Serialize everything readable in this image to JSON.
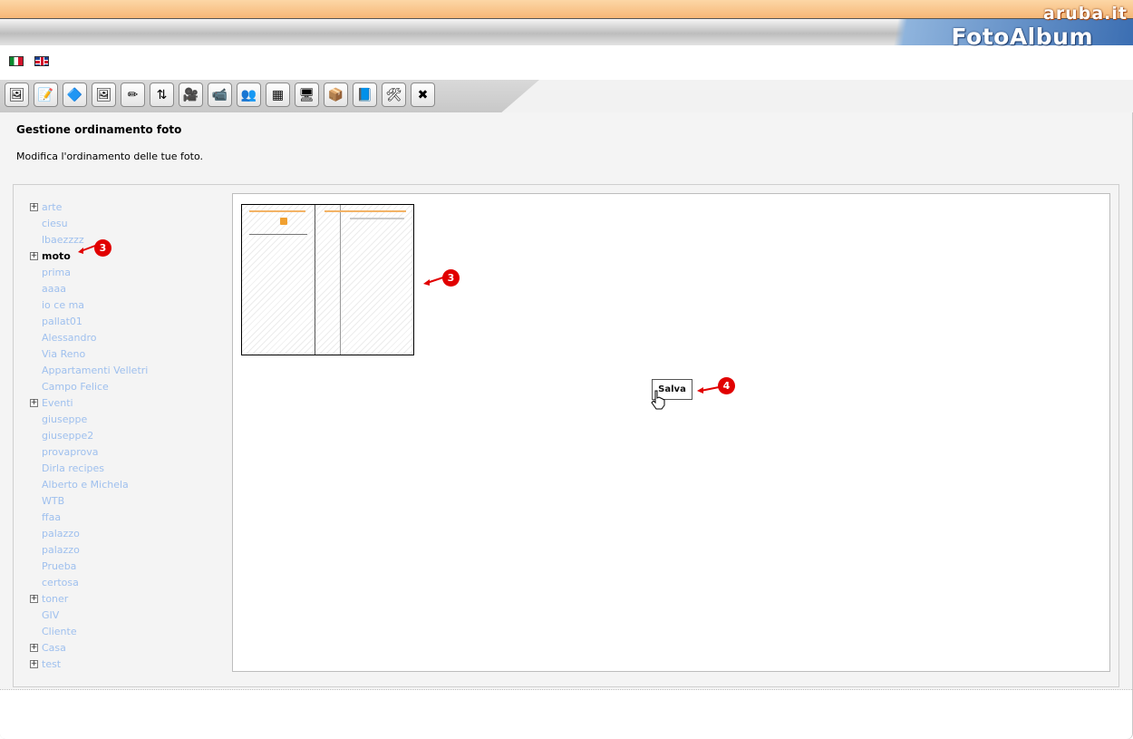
{
  "header": {
    "brand_top": "aruba.it",
    "brand_main": "FotoAlbum"
  },
  "languages": [
    "it-flag-icon",
    "uk-flag-icon"
  ],
  "toolbar": {
    "buttons": [
      {
        "name": "album-icon",
        "glyph": "🖼"
      },
      {
        "name": "edit-album-icon",
        "glyph": "📝"
      },
      {
        "name": "tag-icon",
        "glyph": "🔷"
      },
      {
        "name": "add-photo-icon",
        "glyph": "🖼"
      },
      {
        "name": "edit-photo-icon",
        "glyph": "✏"
      },
      {
        "name": "sort-icon",
        "glyph": "⇅"
      },
      {
        "name": "add-video-icon",
        "glyph": "🎥"
      },
      {
        "name": "edit-video-icon",
        "glyph": "📹"
      },
      {
        "name": "share-icon",
        "glyph": "👥"
      },
      {
        "name": "grid-edit-icon",
        "glyph": "▦"
      },
      {
        "name": "monitor-icon",
        "glyph": "🖥"
      },
      {
        "name": "package-icon",
        "glyph": "📦"
      },
      {
        "name": "help-book-icon",
        "glyph": "📘"
      },
      {
        "name": "tools-icon",
        "glyph": "🛠"
      },
      {
        "name": "delete-icon",
        "glyph": "✖"
      }
    ]
  },
  "page": {
    "title": "Gestione ordinamento foto",
    "description": "Modifica l'ordinamento delle tue foto."
  },
  "tree": [
    {
      "label": "arte",
      "level": 0,
      "expandable": true
    },
    {
      "label": "ciesu",
      "level": 1
    },
    {
      "label": "lbaezzzz",
      "level": 1
    },
    {
      "label": "moto",
      "level": 0,
      "expandable": true,
      "active": true
    },
    {
      "label": "prima",
      "level": 1
    },
    {
      "label": "aaaa",
      "level": 1
    },
    {
      "label": "io ce ma",
      "level": 1
    },
    {
      "label": "pallat01",
      "level": 1
    },
    {
      "label": "Alessandro",
      "level": 1
    },
    {
      "label": "Via Reno",
      "level": 1
    },
    {
      "label": "Appartamenti Velletri",
      "level": 1
    },
    {
      "label": "Campo Felice",
      "level": 1
    },
    {
      "label": "Eventi",
      "level": 0,
      "expandable": true
    },
    {
      "label": "giuseppe",
      "level": 1
    },
    {
      "label": "giuseppe2",
      "level": 1
    },
    {
      "label": "provaprova",
      "level": 1
    },
    {
      "label": "Dirla recipes",
      "level": 1
    },
    {
      "label": "Alberto e Michela",
      "level": 1
    },
    {
      "label": "WTB",
      "level": 1
    },
    {
      "label": "ffaa",
      "level": 1
    },
    {
      "label": "palazzo",
      "level": 1
    },
    {
      "label": "palazzo",
      "level": 1
    },
    {
      "label": "Prueba",
      "level": 1
    },
    {
      "label": "certosa",
      "level": 1
    },
    {
      "label": "toner",
      "level": 0,
      "expandable": true
    },
    {
      "label": "GIV",
      "level": 1
    },
    {
      "label": "Cliente",
      "level": 1
    },
    {
      "label": "Casa",
      "level": 0,
      "expandable": true
    },
    {
      "label": "test",
      "level": 0,
      "expandable": true
    }
  ],
  "sort_panel": {
    "save_label": "Salva"
  },
  "annotations": {
    "tree_marker": "3",
    "thumb_marker": "3",
    "save_marker": "4"
  }
}
